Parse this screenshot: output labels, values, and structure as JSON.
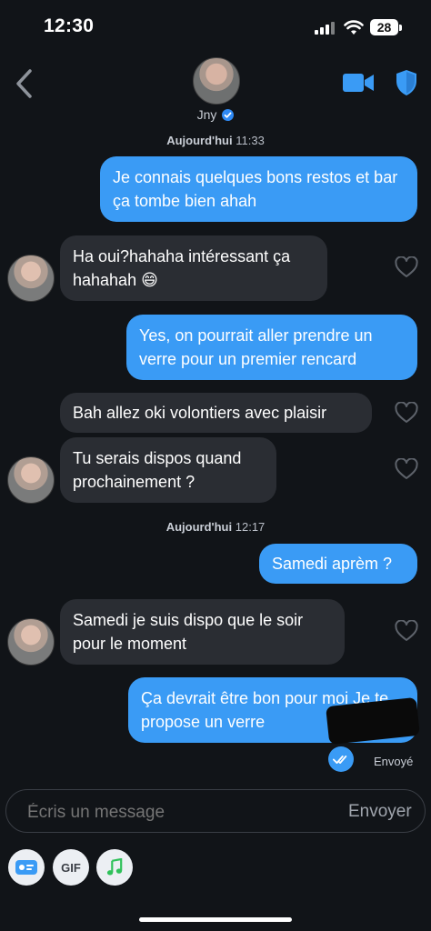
{
  "status": {
    "time": "12:30",
    "battery": "28"
  },
  "header": {
    "name": "Jny"
  },
  "timestamps": [
    {
      "day": "Aujourd'hui",
      "time": "11:33"
    },
    {
      "day": "Aujourd'hui",
      "time": "12:17"
    }
  ],
  "messages": [
    {
      "text": "Je connais quelques bons restos et bar ça tombe bien ahah",
      "from": "me"
    },
    {
      "text": "Ha oui?hahaha intéressant ça hahahah 😄",
      "from": "them"
    },
    {
      "text": "Yes, on pourrait aller prendre un verre pour un premier rencard",
      "from": "me"
    },
    {
      "text": "Bah allez oki volontiers avec plaisir",
      "from": "them"
    },
    {
      "text": "Tu serais dispos quand prochainement ?",
      "from": "them"
    },
    {
      "text": "Samedi aprèm ?",
      "from": "me"
    },
    {
      "text": "Samedi je suis dispo que le soir pour le moment",
      "from": "them"
    },
    {
      "text": "Ça devrait être bon pour moi Je te propose un verre",
      "from": "me"
    }
  ],
  "sent_status": "Envoyé",
  "composer": {
    "placeholder": "Écris un message",
    "send_label": "Envoyer"
  },
  "tools": {
    "gif_label": "GIF"
  },
  "colors": {
    "accent": "#3a9bf5",
    "background": "#111418",
    "incoming_bubble": "#2a2d33"
  }
}
